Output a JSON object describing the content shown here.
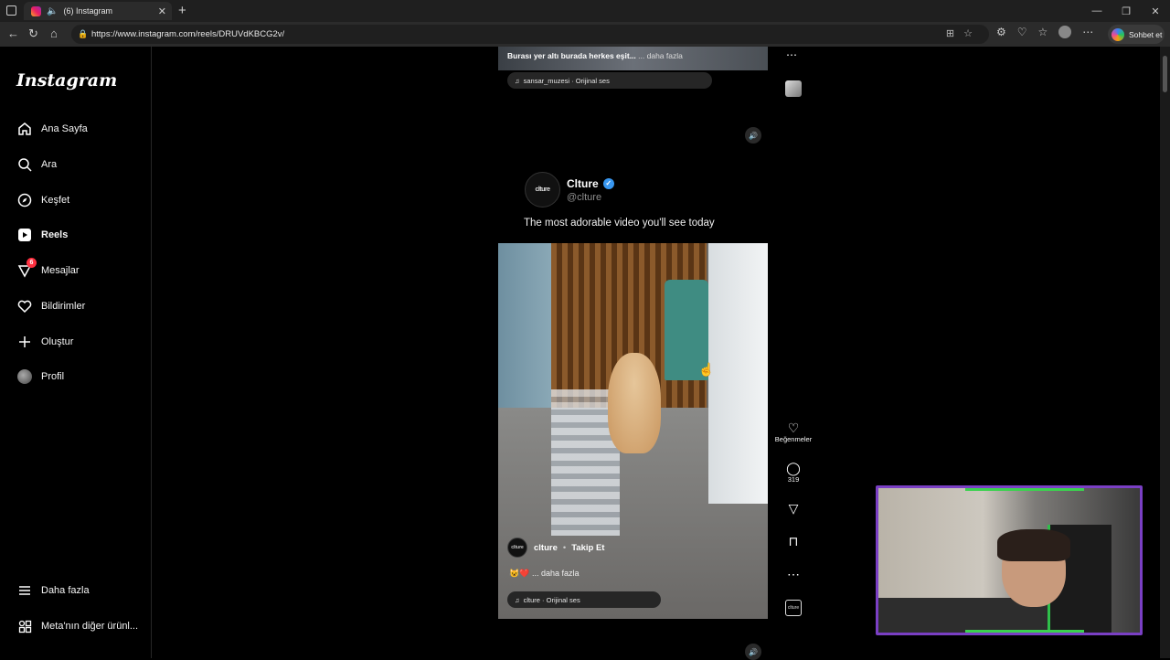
{
  "browser": {
    "tab_title": "(6) Instagram",
    "url": "https://www.instagram.com/reels/DRUVdKBCG2v/",
    "copilot_label": "Sohbet et"
  },
  "sidebar": {
    "logo": "Instagram",
    "items": [
      {
        "label": "Ana Sayfa",
        "icon": "home-icon"
      },
      {
        "label": "Ara",
        "icon": "search-icon"
      },
      {
        "label": "Keşfet",
        "icon": "compass-icon"
      },
      {
        "label": "Reels",
        "icon": "reels-icon"
      },
      {
        "label": "Mesajlar",
        "icon": "messenger-icon",
        "badge": "6"
      },
      {
        "label": "Bildirimler",
        "icon": "heart-icon"
      },
      {
        "label": "Oluştur",
        "icon": "plus-icon"
      },
      {
        "label": "Profil",
        "icon": "avatar"
      }
    ],
    "more": "Daha fazla",
    "meta": "Meta'nın diğer ürünl..."
  },
  "top_reel": {
    "caption": "Burası yer altı burada herkes eşit...",
    "more": "... daha fazla",
    "audio": "sansar_muzesi · Orijinal ses"
  },
  "post": {
    "logo_text": "clture",
    "name": "Clture",
    "handle": "@clture",
    "text": "The most adorable video you'll see today"
  },
  "video": {
    "username": "clture",
    "separator": "•",
    "follow": "Takip Et",
    "caption_emoji": "😺❤️",
    "caption_more": "... daha fazla",
    "audio": "clture · Orijinal ses"
  },
  "actions": {
    "like_label": "Beğenmeler",
    "comments_count": "319"
  }
}
